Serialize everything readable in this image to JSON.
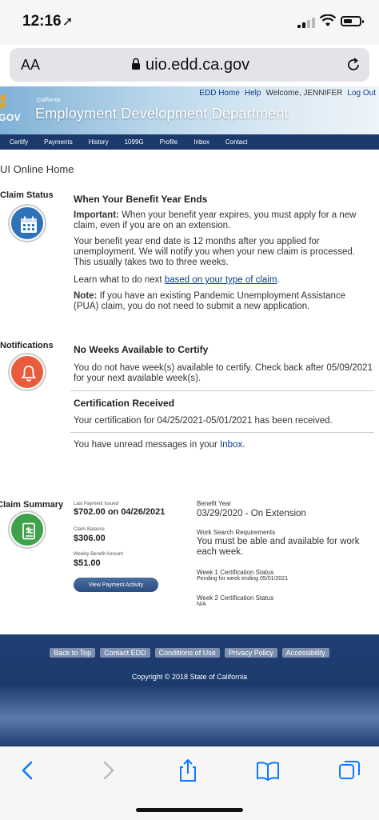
{
  "status_bar": {
    "time": "12:16",
    "location_glyph": "➚"
  },
  "browser": {
    "text_size_label": "AA",
    "url": "uio.edd.ca.gov"
  },
  "header": {
    "ca_number": "4",
    "ca_gov": "GOV",
    "california": "California",
    "dept_name": "Employment Development Department",
    "links": {
      "home": "EDD Home",
      "help": "Help",
      "welcome": "Welcome, JENNIFER",
      "logout": "Log Out"
    }
  },
  "nav": [
    "Certify",
    "Payments",
    "History",
    "1099G",
    "Profile",
    "Inbox",
    "Contact"
  ],
  "page_title": "UI Online Home",
  "claim_status": {
    "label": "Claim Status",
    "heading": "When Your Benefit Year Ends",
    "important_label": "Important:",
    "important_text": "When your benefit year expires, you must apply for a new claim, even if you are on an extension.",
    "para1": "Your benefit year end date is 12 months after you applied for unemployment. We will notify you when your new claim is processed. This usually takes two to three weeks.",
    "learn_prefix": "Learn what to do next ",
    "learn_link": "based on your type of claim",
    "learn_suffix": ".",
    "note_label": "Note:",
    "note_text": "If you have an existing Pandemic Unemployment Assistance (PUA) claim, you do not need to submit a new application."
  },
  "notifications": {
    "label": "Notifications",
    "heading1": "No Weeks Available to Certify",
    "text1": "You do not have week(s) available to certify. Check back after 05/09/2021 for your next available week(s).",
    "heading2": "Certification Received",
    "text2": "Your certification for 04/25/2021-05/01/2021 has been received.",
    "inbox_prefix": "You have unread messages in your ",
    "inbox_link": "Inbox",
    "inbox_suffix": "."
  },
  "claim_summary": {
    "label": "Claim Summary",
    "last_payment_label": "Last Payment Issued",
    "last_payment_value": "$702.00 on 04/26/2021",
    "claim_balance_label": "Claim Balance",
    "claim_balance_value": "$306.00",
    "wba_label": "Weekly Benefit Amount",
    "wba_value": "$51.00",
    "view_button": "View Payment Activity",
    "benefit_year_label": "Benefit Year",
    "benefit_year_value": "03/29/2020 - On Extension",
    "work_search_label": "Work Search Requirements",
    "work_search_value": "You must be able and available for work each week.",
    "week1_label": "Week 1 Certification Status",
    "week1_value": "Pending for week ending 05/01/2021",
    "week2_label": "Week 2 Certification Status",
    "week2_value": "N/A"
  },
  "footer": {
    "links": [
      "Back to Top",
      "Contact EDD",
      "Conditions of Use",
      "Privacy Policy",
      "Accessibility"
    ],
    "copyright": "Copyright © 2018 State of California"
  },
  "colors": {
    "nav_bg": "#1b3a6b",
    "link": "#0b3c8c",
    "claim_icon": "#2f72b8",
    "notif_icon": "#e85c3d",
    "summary_icon": "#3fa24b",
    "ios_blue": "#0a7aff"
  }
}
